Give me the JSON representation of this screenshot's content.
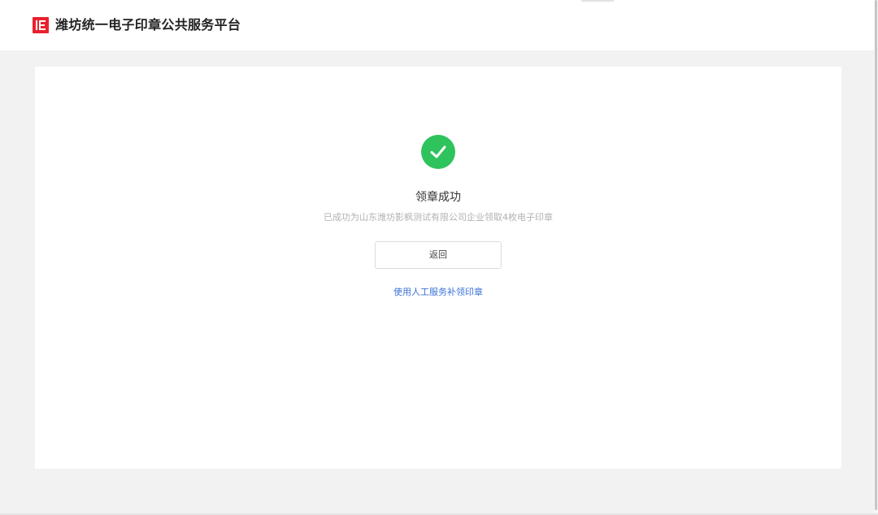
{
  "header": {
    "site_title": "潍坊统一电子印章公共服务平台",
    "logo_icon": "brand-logo-icon",
    "brand_color": "#e8222c"
  },
  "result": {
    "status": "success",
    "icon": "check-circle-icon",
    "icon_color": "#2fc35d",
    "title": "领章成功",
    "description": "已成功为山东潍坊影枫测试有限公司企业领取4枚电子印章"
  },
  "actions": {
    "back_label": "返回",
    "manual_service_link": "使用人工服务补领印章",
    "link_color": "#3b73d6"
  }
}
